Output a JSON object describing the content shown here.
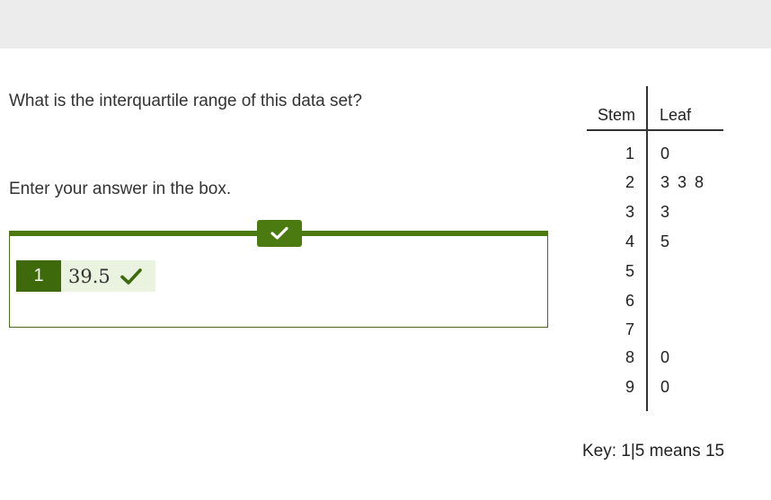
{
  "question": "What is the interquartile range of this data set?",
  "instruction": "Enter your answer in the box.",
  "answer": {
    "number": "1",
    "value": "39.5",
    "status_icon": "check-icon",
    "status": "correct"
  },
  "stem_leaf": {
    "stem_header": "Stem",
    "leaf_header": "Leaf",
    "rows": [
      {
        "stem": "1",
        "leaves": "0"
      },
      {
        "stem": "2",
        "leaves": "3 3 8"
      },
      {
        "stem": "3",
        "leaves": "3"
      },
      {
        "stem": "4",
        "leaves": "5"
      },
      {
        "stem": "5",
        "leaves": ""
      },
      {
        "stem": "6",
        "leaves": ""
      },
      {
        "stem": "7",
        "leaves": ""
      },
      {
        "stem": "8",
        "leaves": "0"
      },
      {
        "stem": "9",
        "leaves": "0"
      }
    ],
    "key": "Key: 1|5 means 15"
  },
  "colors": {
    "accent": "#4a7a10",
    "chip_bg": "#e9f3df",
    "top_bar": "#ececec"
  }
}
